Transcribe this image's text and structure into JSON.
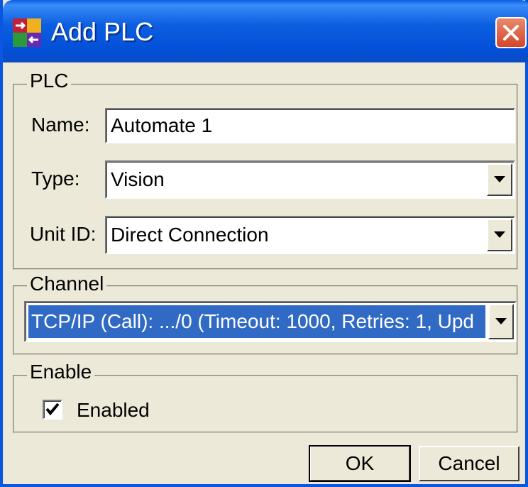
{
  "window": {
    "title": "Add PLC"
  },
  "plc_group": {
    "legend": "PLC",
    "name_label": "Name:",
    "name_value": "Automate 1",
    "type_label": "Type:",
    "type_value": "Vision",
    "unitid_label": "Unit ID:",
    "unitid_value": "Direct Connection"
  },
  "channel_group": {
    "legend": "Channel",
    "channel_value": "TCP/IP (Call): .../0 (Timeout: 1000, Retries: 1, Upd"
  },
  "enable_group": {
    "legend": "Enable",
    "enabled_label": "Enabled",
    "enabled_checked": true
  },
  "buttons": {
    "ok": "OK",
    "cancel": "Cancel"
  },
  "colors": {
    "titlebar": "#0a5fe8",
    "selection": "#316ac5",
    "close": "#d4462a",
    "face": "#ece9d8"
  },
  "icons": {
    "app": "plc-app-icon",
    "close": "close-icon",
    "dropdown": "chevron-down-icon",
    "check": "checkmark-icon"
  }
}
